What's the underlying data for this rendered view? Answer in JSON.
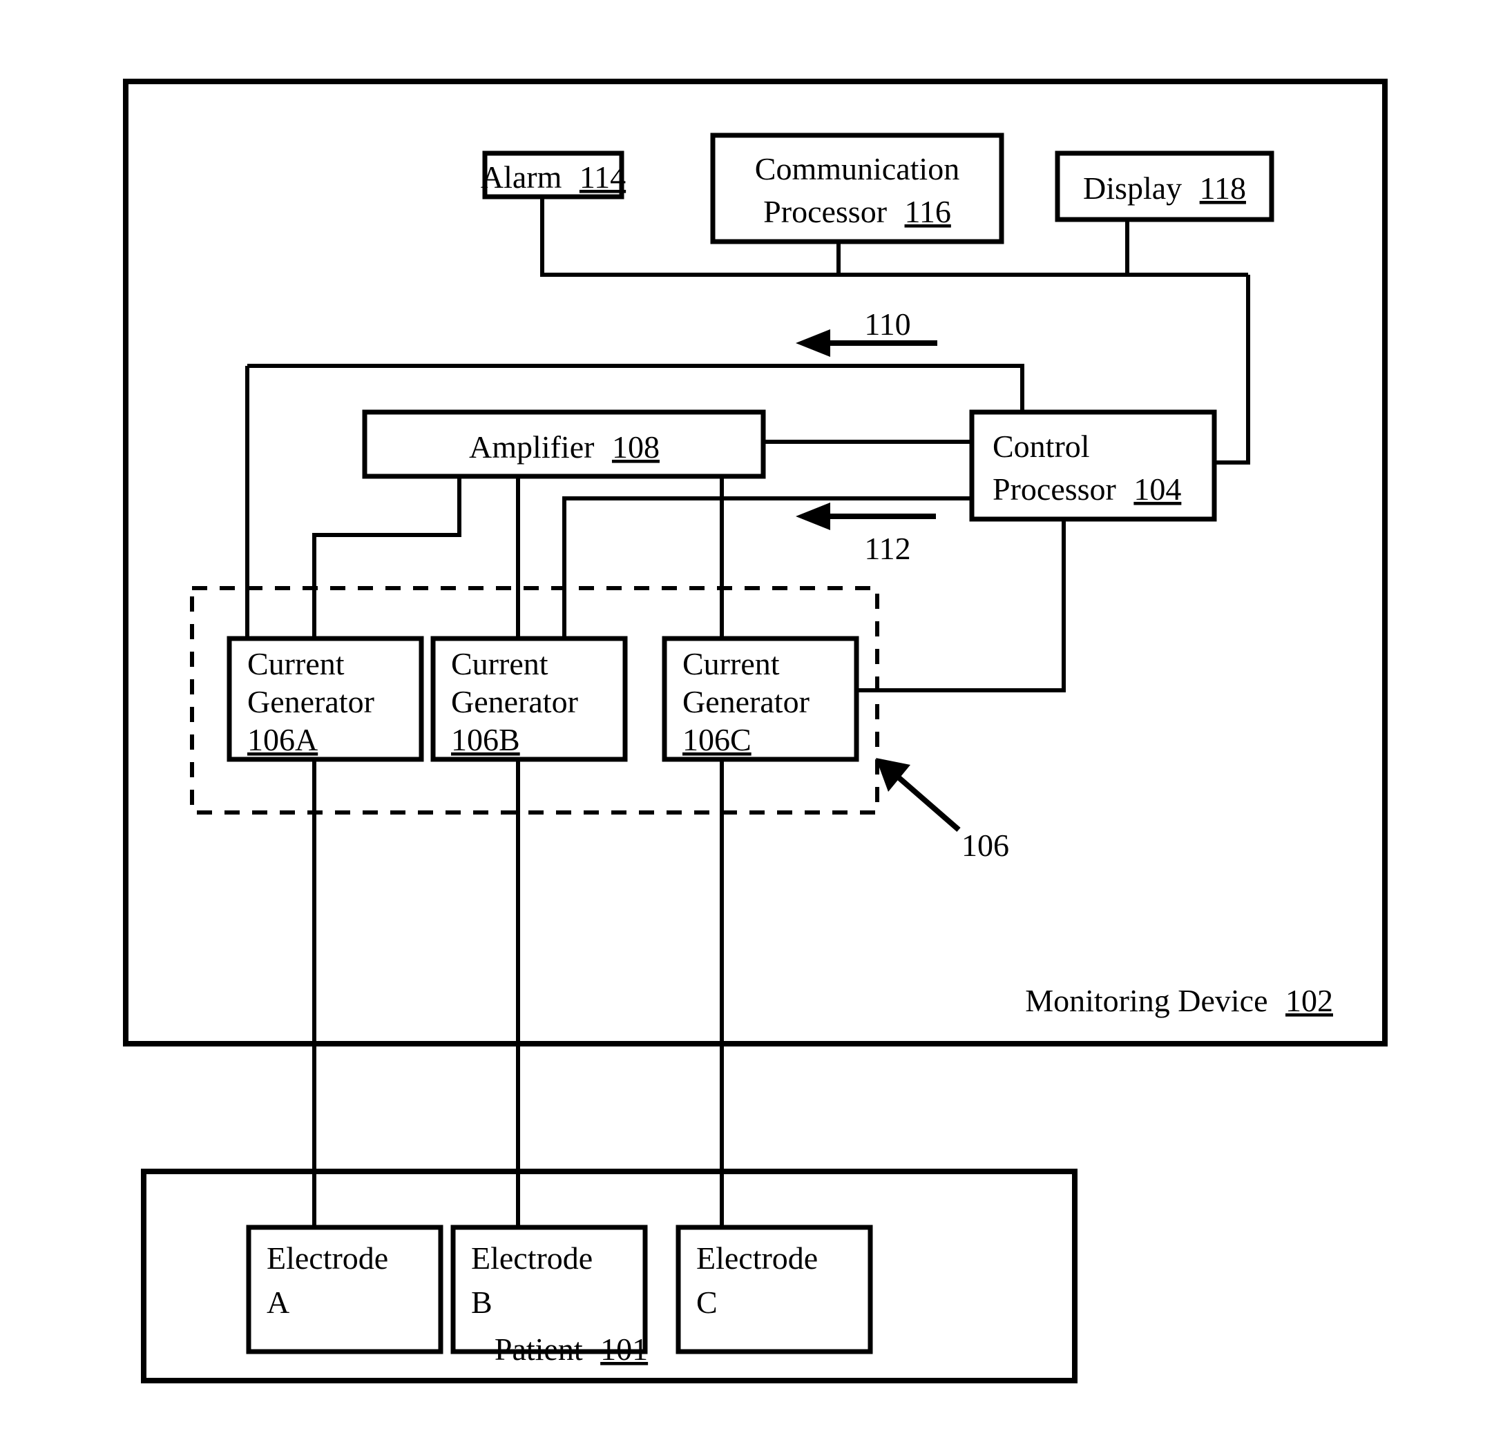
{
  "figure": {
    "type": "patent-block-diagram",
    "title": "Monitoring Device Block Diagram"
  },
  "outer_container": {
    "label": "Monitoring Device",
    "ref": "102"
  },
  "patient_container": {
    "label": "Patient",
    "ref": "101"
  },
  "generator_group": {
    "ref": "106",
    "style": "dashed"
  },
  "boxes": {
    "alarm": {
      "label": "Alarm",
      "ref": "114"
    },
    "comm_line1": {
      "label": "Communication"
    },
    "comm_line2": {
      "label": "Processor",
      "ref": "116"
    },
    "display": {
      "label": "Display",
      "ref": "118"
    },
    "amplifier": {
      "label": "Amplifier",
      "ref": "108"
    },
    "control_line1": {
      "label": "Control"
    },
    "control_line2": {
      "label": "Processor",
      "ref": "104"
    },
    "cg_a": {
      "line1": "Current",
      "line2": "Generator",
      "ref": "106A"
    },
    "cg_b": {
      "line1": "Current",
      "line2": "Generator",
      "ref": "106B"
    },
    "cg_c": {
      "line1": "Current",
      "line2": "Generator",
      "ref": "106C"
    },
    "electrode_a": {
      "line1": "Electrode",
      "line2": "A"
    },
    "electrode_b": {
      "line1": "Electrode",
      "line2": "B"
    },
    "electrode_c": {
      "line1": "Electrode",
      "line2": "C"
    }
  },
  "signal_labels": {
    "s110": "110",
    "s112": "112",
    "s106": "106"
  },
  "colors": {
    "ink": "#000000",
    "paper": "#ffffff"
  }
}
